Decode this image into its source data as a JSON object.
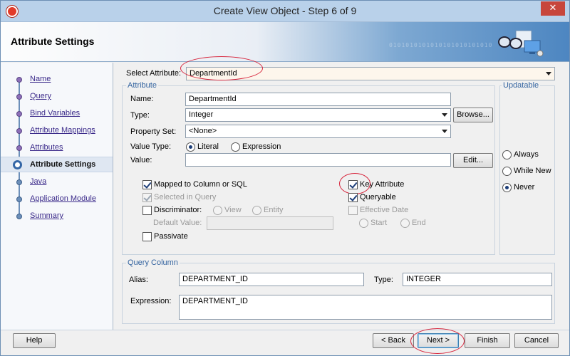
{
  "window": {
    "title": "Create View Object - Step 6 of 9",
    "close_glyph": "✕"
  },
  "banner": {
    "heading": "Attribute Settings",
    "binary_text": "0101010101010101010101010"
  },
  "nav": {
    "items": [
      {
        "label": "Name",
        "state": "done"
      },
      {
        "label": "Query",
        "state": "done"
      },
      {
        "label": "Bind Variables",
        "state": "done"
      },
      {
        "label": "Attribute Mappings",
        "state": "done"
      },
      {
        "label": "Attributes",
        "state": "done"
      },
      {
        "label": "Attribute Settings",
        "state": "current"
      },
      {
        "label": "Java",
        "state": "future"
      },
      {
        "label": "Application Module",
        "state": "future"
      },
      {
        "label": "Summary",
        "state": "future"
      }
    ]
  },
  "select_attribute": {
    "label": "Select Attribute:",
    "value": "DepartmentId"
  },
  "attribute": {
    "group_title": "Attribute",
    "name_label": "Name:",
    "name_value": "DepartmentId",
    "type_label": "Type:",
    "type_value": "Integer",
    "browse_label": "Browse...",
    "property_set_label": "Property Set:",
    "property_set_value": "<None>",
    "value_type_label": "Value Type:",
    "literal_label": "Literal",
    "expression_label": "Expression",
    "value_label": "Value:",
    "value_value": "",
    "edit_label": "Edit...",
    "mapped_label": "Mapped to Column or SQL",
    "selected_in_query_label": "Selected in Query",
    "discriminator_label": "Discriminator:",
    "view_label": "View",
    "entity_label": "Entity",
    "default_value_label": "Default Value:",
    "default_value_value": "",
    "passivate_label": "Passivate",
    "key_attribute_label": "Key Attribute",
    "queryable_label": "Queryable",
    "effective_date_label": "Effective Date",
    "start_label": "Start",
    "end_label": "End"
  },
  "updatable": {
    "group_title": "Updatable",
    "options": [
      "Always",
      "While New",
      "Never"
    ],
    "selected": "Never"
  },
  "query_column": {
    "group_title": "Query Column",
    "alias_label": "Alias:",
    "alias_value": "DEPARTMENT_ID",
    "type_label": "Type:",
    "type_value": "INTEGER",
    "expression_label": "Expression:",
    "expression_value": "DEPARTMENT_ID"
  },
  "footer": {
    "help": "Help",
    "back": "< Back",
    "next": "Next >",
    "finish": "Finish",
    "cancel": "Cancel"
  },
  "colors": {
    "accent": "#3464a0",
    "highlight_ring": "#d7263d",
    "titlebar": "#b9d1ea"
  }
}
